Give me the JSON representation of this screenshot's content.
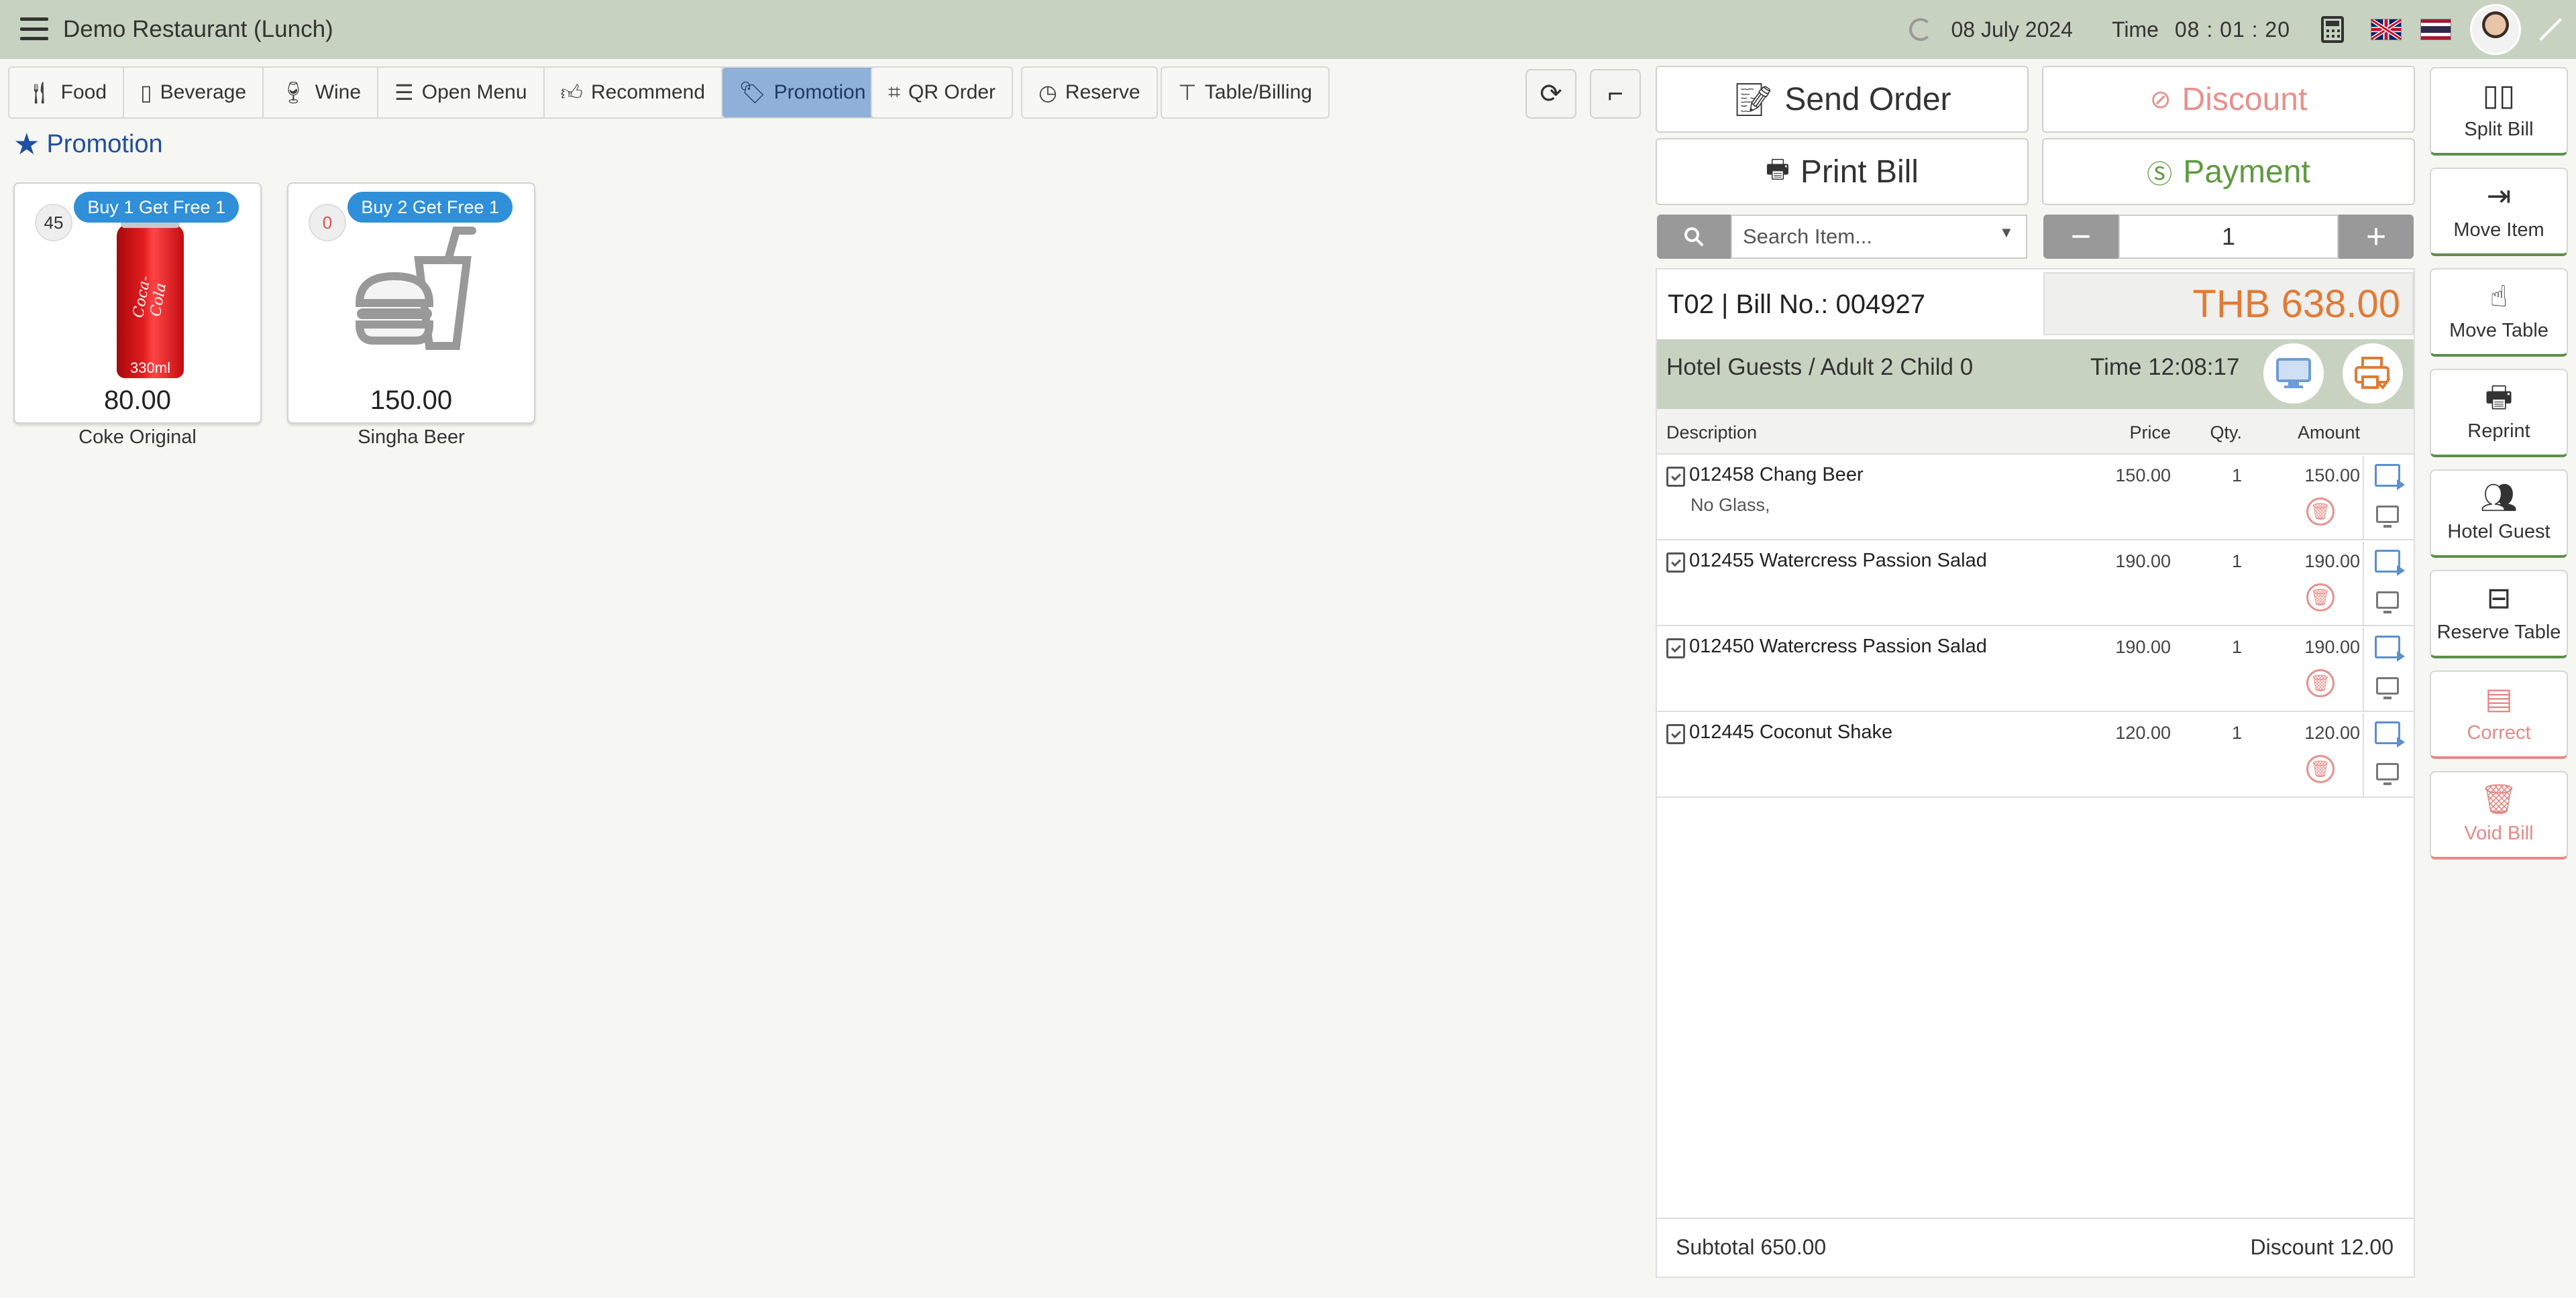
{
  "app": {
    "title": "Demo Restaurant (Lunch)"
  },
  "topbar": {
    "date": "08 July 2024",
    "time_label": "Time",
    "time": "08 : 01 : 20"
  },
  "tabs": [
    {
      "label": "Food",
      "icon": "cutlery-icon"
    },
    {
      "label": "Beverage",
      "icon": "cup-icon"
    },
    {
      "label": "Wine",
      "icon": "wine-icon"
    },
    {
      "label": "Open Menu",
      "icon": "menu-list-icon"
    },
    {
      "label": "Recommend",
      "icon": "thumbs-up-icon"
    },
    {
      "label": "Promotion",
      "icon": "tag-icon",
      "active": true
    }
  ],
  "extra_tabs": [
    {
      "label": "QR Order",
      "icon": "qr-icon"
    },
    {
      "label": "Reserve",
      "icon": "clock-icon"
    },
    {
      "label": "Table/Billing",
      "icon": "table-icon"
    }
  ],
  "section": {
    "title": "Promotion"
  },
  "products": [
    {
      "name": "Coke Original",
      "price": "80.00",
      "count": "45",
      "badge": "Buy 1 Get Free 1",
      "can_brand": "Coca-Cola",
      "can_size": "330ml"
    },
    {
      "name": "Singha Beer",
      "price": "150.00",
      "count": "0",
      "badge": "Buy 2 Get Free 1"
    }
  ],
  "actions": {
    "send_order": "Send Order",
    "discount": "Discount",
    "print_bill": "Print Bill",
    "payment": "Payment"
  },
  "search": {
    "placeholder": "Search Item..."
  },
  "quantity": {
    "value": "1",
    "minus": "−",
    "plus": "+"
  },
  "bill": {
    "number": "T02 | Bill No.: 004927",
    "total": "THB 638.00",
    "guest": "Hotel Guests / Adult 2 Child 0",
    "time": "Time 12:08:17",
    "columns": {
      "description": "Description",
      "price": "Price",
      "qty": "Qty.",
      "amount": "Amount"
    },
    "items": [
      {
        "description": "012458 Chang Beer",
        "note": "No Glass,",
        "price": "150.00",
        "qty": "1",
        "amount": "150.00"
      },
      {
        "description": "012455 Watercress Passion Salad",
        "note": "",
        "price": "190.00",
        "qty": "1",
        "amount": "190.00"
      },
      {
        "description": "012450 Watercress Passion Salad",
        "note": "",
        "price": "190.00",
        "qty": "1",
        "amount": "190.00"
      },
      {
        "description": "012445 Coconut Shake",
        "note": "",
        "price": "120.00",
        "qty": "1",
        "amount": "120.00"
      }
    ],
    "subtotal": "Subtotal 650.00",
    "discount": "Discount 12.00"
  },
  "side_actions": [
    {
      "label": "Split Bill",
      "icon": "split-icon"
    },
    {
      "label": "Move Item",
      "icon": "move-item-icon"
    },
    {
      "label": "Move Table",
      "icon": "hand-pointer-icon"
    },
    {
      "label": "Reprint",
      "icon": "printer-icon"
    },
    {
      "label": "Hotel Guest",
      "icon": "people-icon"
    },
    {
      "label": "Reserve Table",
      "icon": "reserve-table-icon"
    },
    {
      "label": "Correct",
      "icon": "correct-icon"
    },
    {
      "label": "Void Bill",
      "icon": "trash-icon"
    }
  ],
  "colors": {
    "topbar": "#c7d3c0",
    "active_tab": "#8fb0d8",
    "accent_orange": "#e07b36",
    "accent_green": "#5e9b40",
    "danger": "#e8908c",
    "promo_blue": "#2f8fd8"
  }
}
